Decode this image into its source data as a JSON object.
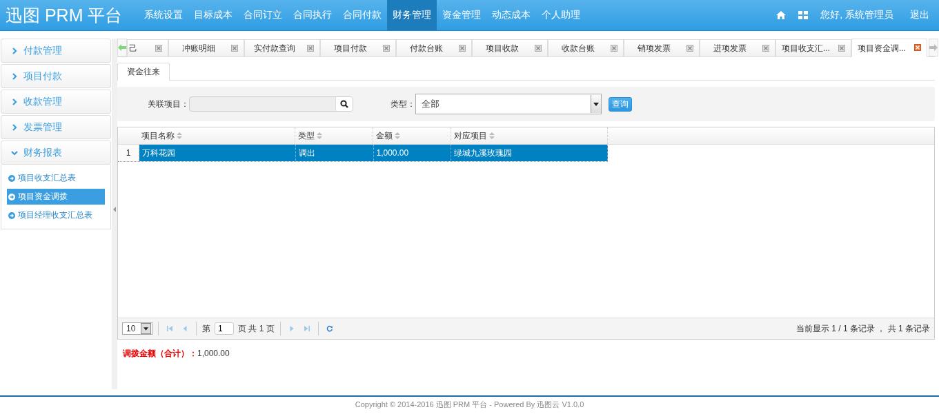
{
  "header": {
    "logo": "迅图 PRM 平台",
    "nav": [
      {
        "label": "系统设置",
        "selected": false
      },
      {
        "label": "目标成本",
        "selected": false
      },
      {
        "label": "合同订立",
        "selected": false
      },
      {
        "label": "合同执行",
        "selected": false
      },
      {
        "label": "合同付款",
        "selected": false
      },
      {
        "label": "财务管理",
        "selected": true
      },
      {
        "label": "资金管理",
        "selected": false
      },
      {
        "label": "动态成本",
        "selected": false
      },
      {
        "label": "个人助理",
        "selected": false
      }
    ],
    "greeting": "您好, 系统管理员",
    "logout": "退出"
  },
  "sidebar": {
    "groups": [
      {
        "label": "付款管理",
        "expanded": false
      },
      {
        "label": "项目付款",
        "expanded": false
      },
      {
        "label": "收款管理",
        "expanded": false
      },
      {
        "label": "发票管理",
        "expanded": false
      },
      {
        "label": "财务报表",
        "expanded": true,
        "children": [
          {
            "label": "项目收支汇总表",
            "selected": false
          },
          {
            "label": "项目资金调拨",
            "selected": true
          },
          {
            "label": "项目经理收支汇总表",
            "selected": false
          }
        ]
      }
    ]
  },
  "tabs": [
    {
      "label": "己",
      "selected": false
    },
    {
      "label": "冲账明细",
      "selected": false
    },
    {
      "label": "实付款查询",
      "selected": false
    },
    {
      "label": "项目付款",
      "selected": false
    },
    {
      "label": "付款台账",
      "selected": false
    },
    {
      "label": "项目收款",
      "selected": false
    },
    {
      "label": "收款台账",
      "selected": false
    },
    {
      "label": "销项发票",
      "selected": false
    },
    {
      "label": "进项发票",
      "selected": false
    },
    {
      "label": "项目收支汇...",
      "selected": false
    },
    {
      "label": "项目资金调...",
      "selected": true
    }
  ],
  "subtabs": [
    {
      "label": "资金往来",
      "selected": true
    }
  ],
  "search": {
    "project_label": "关联项目：",
    "type_label": "类型：",
    "type_value": "全部",
    "query_button": "查询"
  },
  "table": {
    "columns": [
      "项目名称",
      "类型",
      "金额",
      "对应项目"
    ],
    "rows": [
      {
        "number": "1",
        "cells": [
          "万科花园",
          "调出",
          "1,000.00",
          "绿城九溪玫瑰园"
        ],
        "selected": true
      }
    ]
  },
  "pager": {
    "page_size": "10",
    "page_prefix": "第",
    "page": "1",
    "page_suffix": "页 共 1 页",
    "summary": "当前显示 1 / 1 条记录 ， 共 1 条记录"
  },
  "total": {
    "label": "调拨金额（合计）：",
    "value": "1,000.00"
  },
  "footer": "Copyright © 2014-2016 迅图 PRM 平台 - Powered By 迅图云 V1.0.0"
}
